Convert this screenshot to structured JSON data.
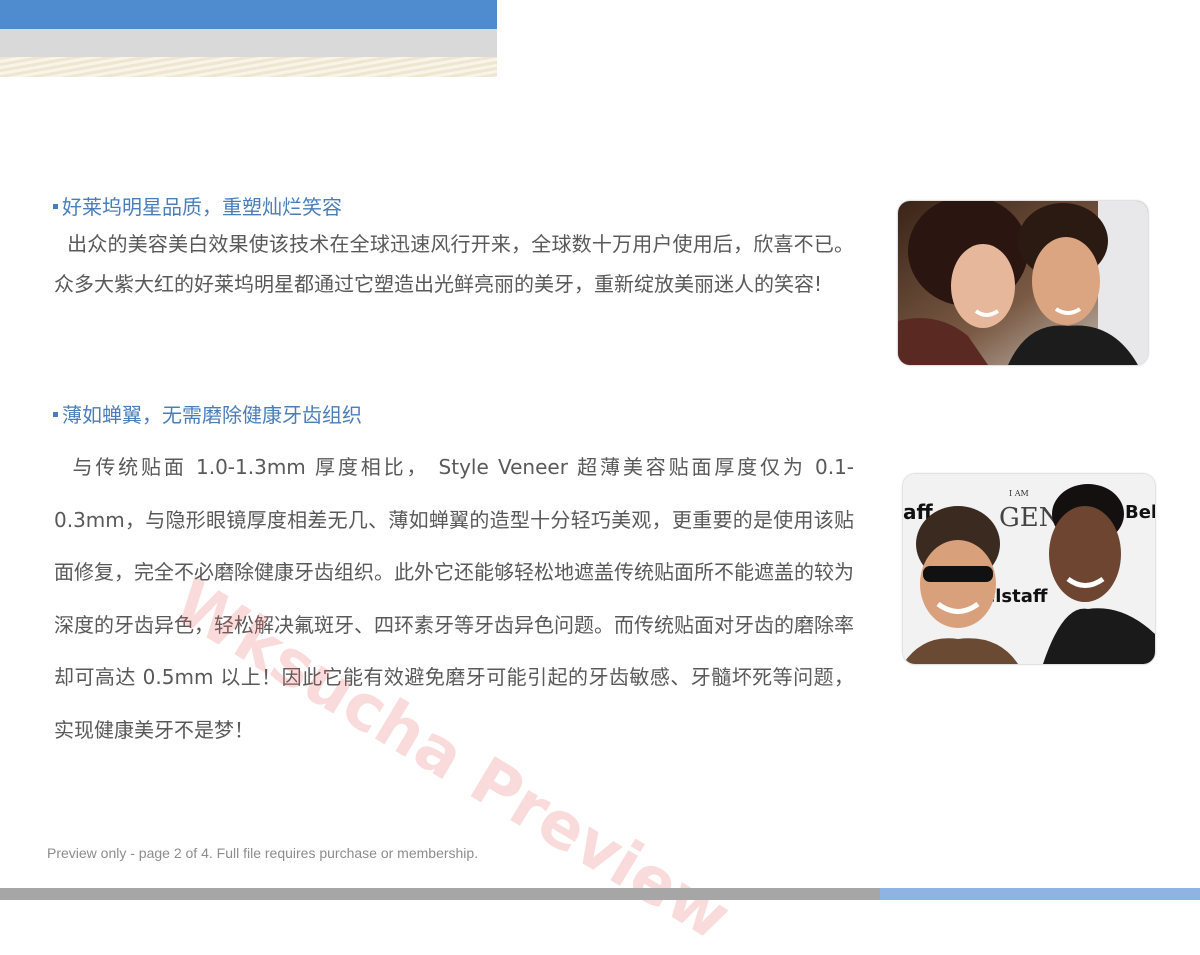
{
  "section1": {
    "heading": "好莱坞明星品质，重塑灿烂笑容",
    "body": "出众的美容美白效果使该技术在全球迅速风行开来，全球数十万用户使用后，欣喜不已。众多大紫大红的好莱坞明星都通过它塑造出光鲜亮丽的美牙，重新绽放美丽迷人的笑容!"
  },
  "section2": {
    "heading": "薄如蝉翼，无需磨除健康牙齿组织",
    "body": "与传统贴面 1.0-1.3mm 厚度相比， Style Veneer 超薄美容贴面厚度仅为 0.1-0.3mm，与隐形眼镜厚度相差无几、薄如蝉翼的造型十分轻巧美观，更重要的是使用该贴面修复，完全不必磨除健康牙齿组织。此外它还能够轻松地遮盖传统贴面所不能遮盖的较为深度的牙齿异色，轻松解决氟斑牙、四环素牙等牙齿异色问题。而传统贴面对牙齿的磨除率却可高达 0.5mm 以上！因此它能有效避免磨牙可能引起的牙齿敏感、牙髓坏死等问题，实现健康美牙不是梦！"
  },
  "photo2_backdrop": {
    "text1": "aff",
    "text2": "I AM",
    "text3": "GEN",
    "text4": "Bel",
    "text5": "elstaff"
  },
  "watermark": "Wksucha Preview",
  "footer_note": "Preview only - page 2 of 4. Full file requires purchase or membership.",
  "colors": {
    "heading": "#4a7ebb",
    "body_text": "#595959",
    "top_bar_blue": "#4f8ccf",
    "bottom_bar_blue": "#8fb4e3",
    "watermark": "#e65a5a"
  }
}
